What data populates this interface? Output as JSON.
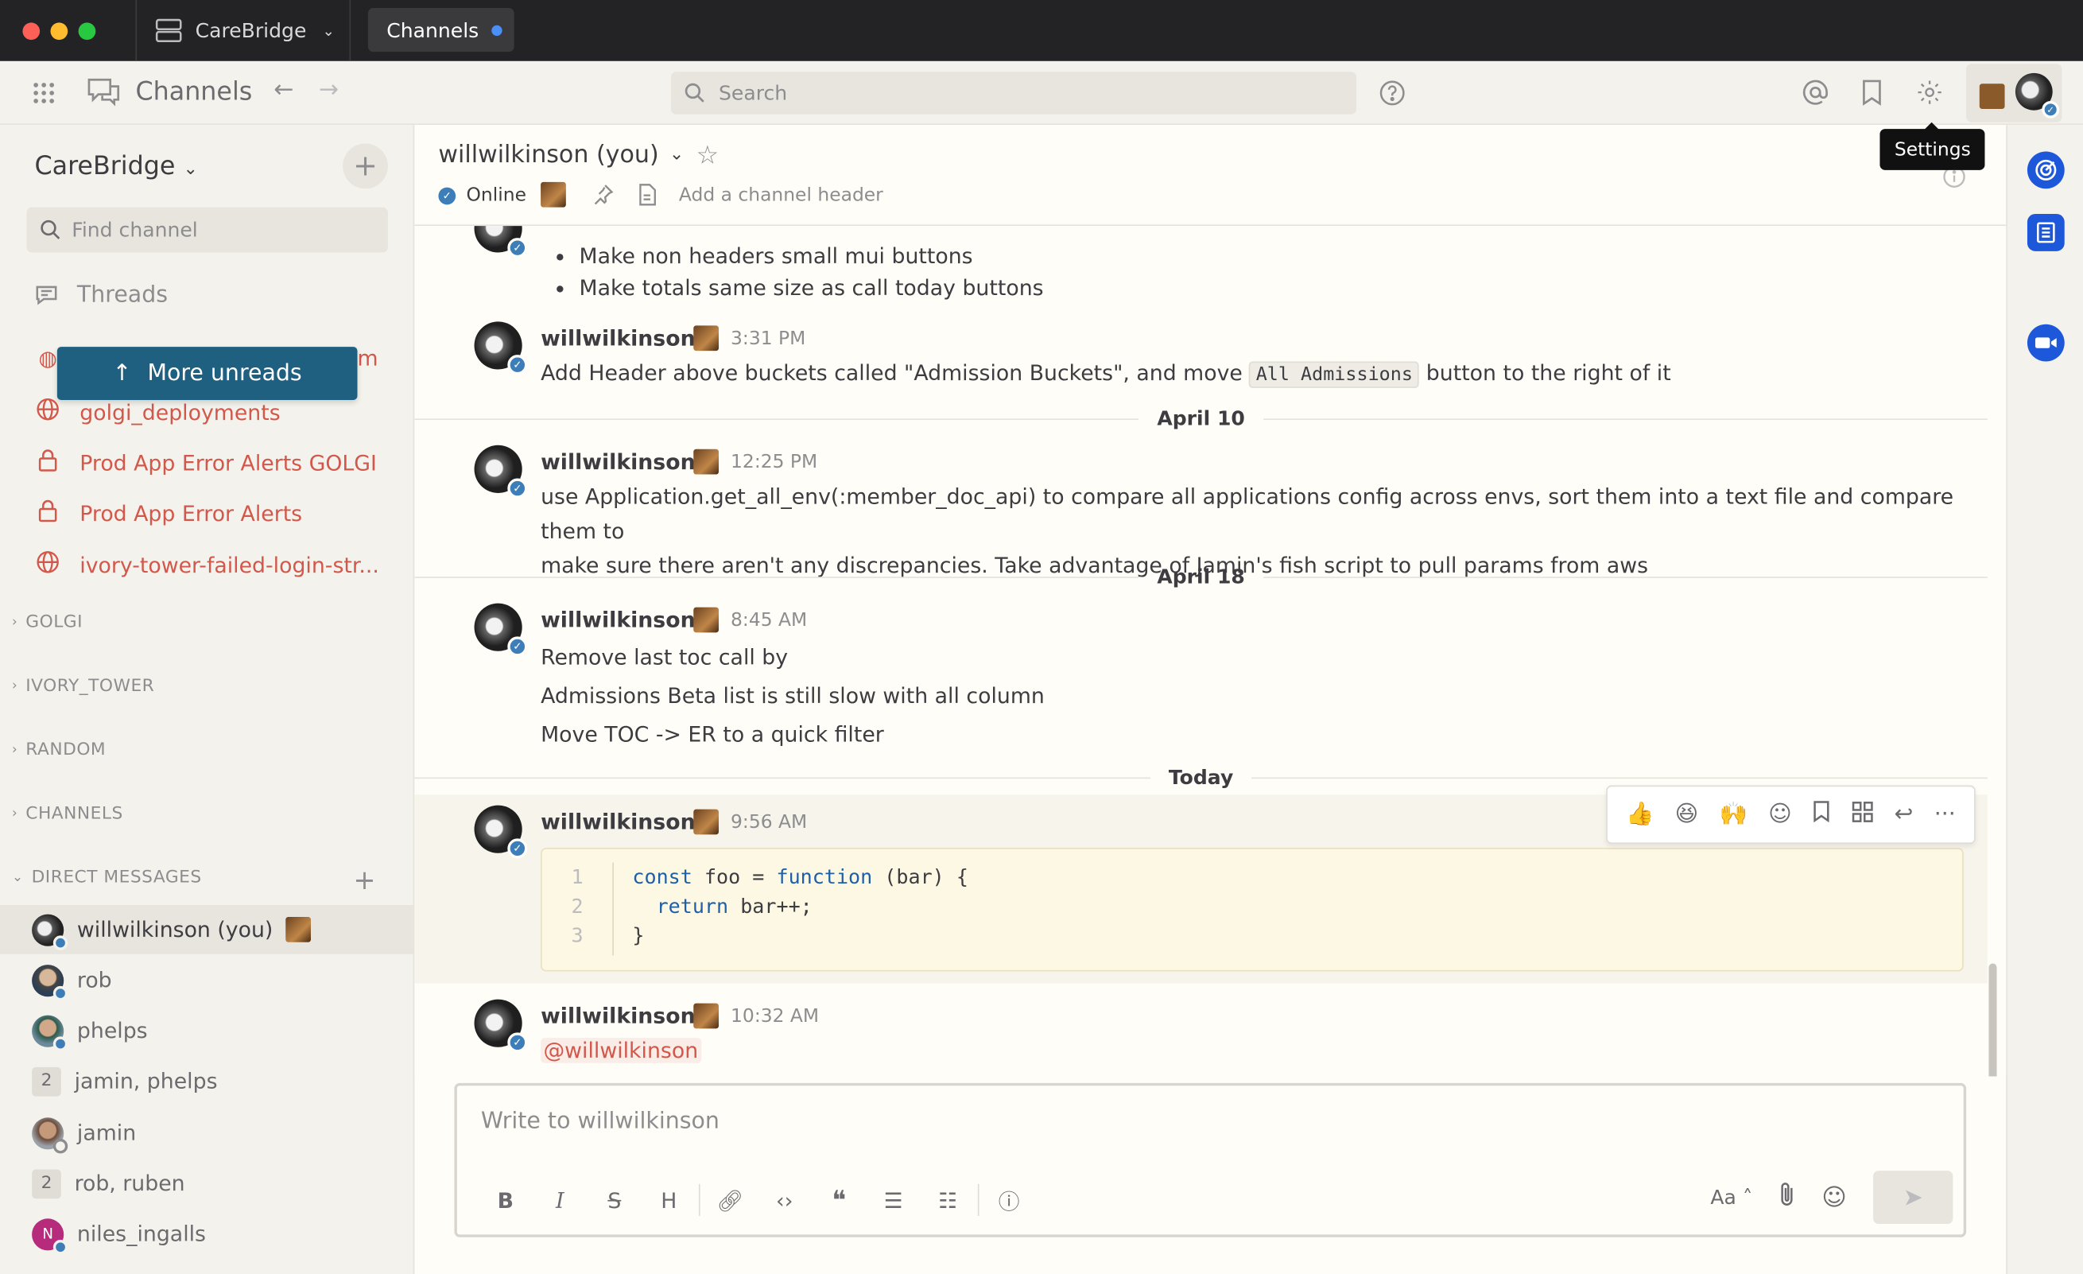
{
  "titlebar": {
    "server_name": "CareBridge",
    "tab_label": "Channels"
  },
  "globalbar": {
    "product_title": "Channels",
    "search_placeholder": "Search",
    "tooltip": "Settings"
  },
  "sidebar": {
    "team_name": "CareBridge",
    "find_placeholder": "Find channel",
    "threads_label": "Threads",
    "more_unreads_label": "More unreads",
    "partial_channel_tail": "m",
    "channels": [
      {
        "label": "golgi_deployments",
        "icon": "globe-icon"
      },
      {
        "label": "Prod App Error Alerts GOLGI",
        "icon": "lock-icon"
      },
      {
        "label": "Prod App Error Alerts",
        "icon": "lock-icon"
      },
      {
        "label": "ivory-tower-failed-login-str...",
        "icon": "globe-icon"
      }
    ],
    "groups": [
      "GOLGI",
      "IVORY_TOWER",
      "RANDOM",
      "CHANNELS",
      "DIRECT MESSAGES"
    ],
    "dms": [
      {
        "label": "willwilkinson (you)"
      },
      {
        "label": "rob"
      },
      {
        "label": "phelps"
      },
      {
        "label": "jamin, phelps",
        "count": "2"
      },
      {
        "label": "jamin"
      },
      {
        "label": "rob, ruben",
        "count": "2"
      },
      {
        "label": "niles_ingalls",
        "initial": "N"
      }
    ]
  },
  "channel": {
    "name": "willwilkinson (you)",
    "status": "Online",
    "header_placeholder": "Add a channel header"
  },
  "messages": {
    "username": "willwilkinson",
    "bullets": [
      "Make non headers small mui buttons",
      "Make totals same size as call today buttons"
    ],
    "post1": {
      "time": "3:31 PM",
      "text_before": "Add Header above buckets called \"Admission Buckets\", and move",
      "code": "All Admissions",
      "text_after": "button to the right of it"
    },
    "date1": "April 10",
    "post2": {
      "time": "12:25 PM",
      "line1": "use Application.get_all_env(:member_doc_api) to compare all applications config across envs, sort them into a text file and compare them to",
      "line2": "make sure there aren't any discrepancies. Take advantage of Jamin's fish script to pull params from aws"
    },
    "date2": "April 18",
    "post3": {
      "time": "8:45 AM",
      "lines": [
        "Remove last toc call by",
        "Admissions Beta list is still slow with all column",
        "Move TOC -> ER to a quick filter"
      ]
    },
    "date3": "Today",
    "post4": {
      "time": "9:56 AM",
      "code_line_numbers": [
        "1",
        "2",
        "3"
      ],
      "code_kw_const": "const",
      "code_l1_mid": " foo = ",
      "code_kw_function": "function",
      "code_l1_end": " (bar) {",
      "code_l2_indent": "  ",
      "code_kw_return": "return",
      "code_l2_end": " bar++;",
      "code_l3": "}"
    },
    "post5": {
      "time": "10:32 AM",
      "mention": "@willwilkinson"
    }
  },
  "composer": {
    "placeholder": "Write to willwilkinson",
    "text_size_label": "Aa"
  },
  "colors": {
    "accent": "#1f5f80",
    "unread": "#d2584b",
    "online": "#3d7db8"
  }
}
